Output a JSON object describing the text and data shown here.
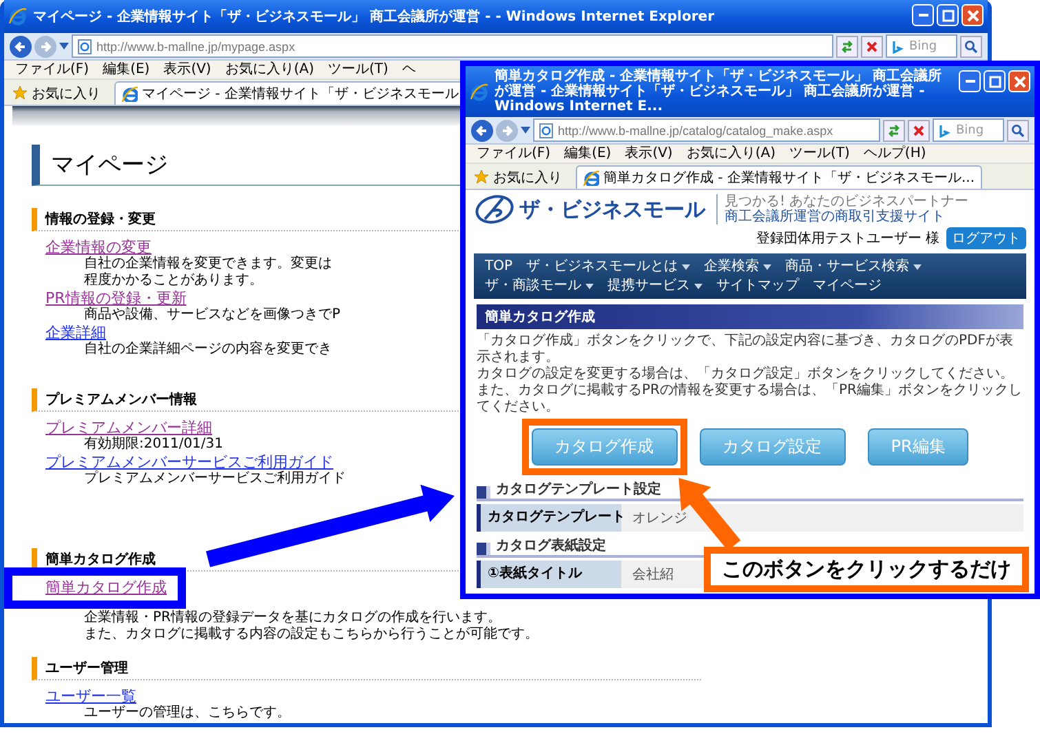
{
  "back_window": {
    "title": "マイページ - 企業情報サイト「ザ・ビジネスモール」 商工会議所が運営 - - Windows Internet Explorer",
    "address": "http://www.b-mallne.jp/mypage.aspx",
    "search": {
      "placeholder": "Bing"
    },
    "menu": [
      "ファイル(F)",
      "編集(E)",
      "表示(V)",
      "お気に入り(A)",
      "ツール(T)",
      "ヘ"
    ],
    "favorites": "お気に入り",
    "tabs": [
      {
        "label": "マイページ - 企業情報サイト「ザ・ビジネスモール",
        "selected": true
      }
    ],
    "page_title": "マイページ",
    "sections": [
      {
        "heading": "情報の登録・変更",
        "items": [
          {
            "link": "企業情報の変更",
            "visited": true,
            "highlighted": false,
            "lines": [
              "自社の企業情報を変更できます。変更は",
              "程度かかることがあります。"
            ]
          },
          {
            "link": "PR情報の登録・更新",
            "visited": true,
            "highlighted": false,
            "lines": [
              "商品や設備、サービスなどを画像つきでP"
            ]
          },
          {
            "link": "企業詳細",
            "visited": false,
            "highlighted": false,
            "lines": [
              "自社の企業詳細ページの内容を変更でき"
            ]
          }
        ]
      },
      {
        "heading": "プレミアムメンバー情報",
        "items": [
          {
            "link": "プレミアムメンバー詳細",
            "visited": true,
            "highlighted": false,
            "lines": [
              "有効期限:2011/01/31"
            ]
          },
          {
            "link": "プレミアムメンバーサービスご利用ガイド",
            "visited": false,
            "highlighted": false,
            "lines": [
              "プレミアムメンバーサービスご利用ガイド"
            ]
          }
        ]
      },
      {
        "heading": "簡単カタログ作成",
        "items": [
          {
            "link": "簡単カタログ作成",
            "visited": true,
            "highlighted": true,
            "lines": [
              "企業情報・PR情報の登録データを基にカタログの作成を行います。",
              "また、カタログに掲載する内容の設定もこちらから行うことが可能です。"
            ]
          }
        ]
      },
      {
        "heading": "ユーザー管理",
        "items": [
          {
            "link": "ユーザー一覧",
            "visited": false,
            "highlighted": false,
            "lines": [
              "ユーザーの管理は、こちらです。"
            ]
          }
        ]
      }
    ]
  },
  "front_window": {
    "title": "簡単カタログ作成 - 企業情報サイト「ザ・ビジネスモール」 商工会議所が運営 - 企業情報サイト「ザ・ビジネスモール」 商工会議所が運営 - Windows Internet E...",
    "address": "http://www.b-mallne.jp/catalog/catalog_make.aspx",
    "search": {
      "placeholder": "Bing"
    },
    "menu": [
      "ファイル(F)",
      "編集(E)",
      "表示(V)",
      "お気に入り(A)",
      "ツール(T)",
      "ヘルプ(H)"
    ],
    "favorites": "お気に入り",
    "tabs": [
      {
        "label": "簡単カタログ作成 - 企業情報サイト「ザ・ビジネスモール...",
        "selected": true
      }
    ],
    "site": {
      "logo": "ザ・ビジネスモール",
      "tagline": "見つかる! あなたのビジネスパートナー",
      "subtitle": "商工会議所運営の商取引支援サイト",
      "user": "登録団体用テストユーザー 様",
      "logout": "ログアウト"
    },
    "nav": [
      {
        "label": "TOP",
        "dropdown": false
      },
      {
        "label": "ザ・ビジネスモールとは",
        "dropdown": true
      },
      {
        "label": "企業検索",
        "dropdown": true
      },
      {
        "label": "商品・サービス検索",
        "dropdown": true
      },
      {
        "label": "ザ・商談モール",
        "dropdown": true
      },
      {
        "label": "提携サービス",
        "dropdown": true
      },
      {
        "label": "サイトマップ",
        "dropdown": false
      },
      {
        "label": "マイページ",
        "dropdown": false
      }
    ],
    "section_title": "簡単カタログ作成",
    "description": [
      "「カタログ作成」ボタンをクリックで、下記の設定内容に基づき、カタログのPDFが表示されます。",
      "カタログの設定を変更する場合は、「カタログ設定」ボタンをクリックしてください。",
      "また、カタログに掲載するPRの情報を変更する場合は、「PR編集」ボタンをクリックしてください。"
    ],
    "buttons": [
      {
        "label": "カタログ作成",
        "highlighted": true
      },
      {
        "label": "カタログ設定",
        "highlighted": false
      },
      {
        "label": "PR編集",
        "highlighted": false
      }
    ],
    "settings": [
      {
        "heading": "カタログテンプレート設定",
        "rows": [
          {
            "label": "カタログテンプレート",
            "value": "オレンジ"
          }
        ]
      },
      {
        "heading": "カタログ表紙設定",
        "rows": [
          {
            "label": "①表紙タイトル",
            "value": "会社紹"
          }
        ]
      }
    ]
  },
  "callout": {
    "text": "このボタンをクリックするだけ"
  }
}
